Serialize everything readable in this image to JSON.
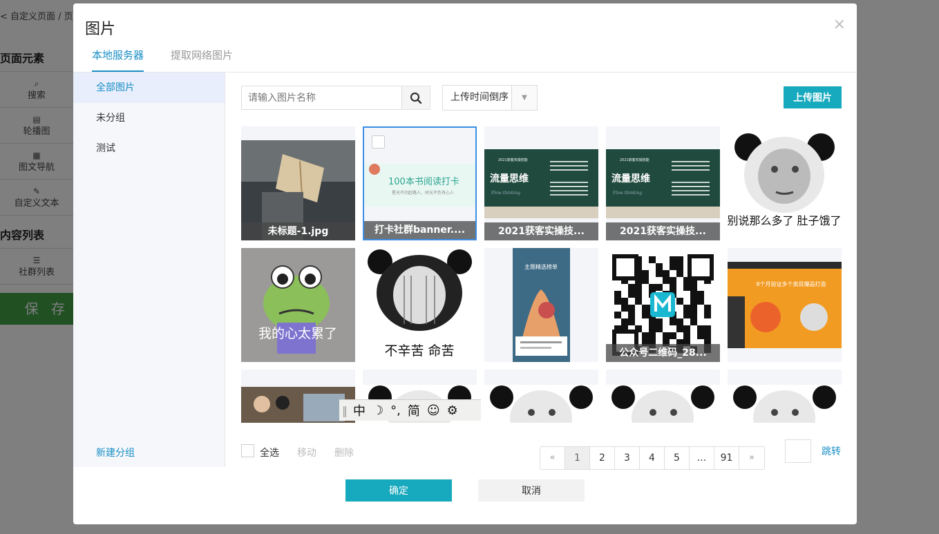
{
  "background": {
    "breadcrumb": "< 自定义页面 / 页",
    "section_page_elements": "页面元素",
    "items": [
      {
        "label": "搜索",
        "icon": "search-icon"
      },
      {
        "label": "轮播图",
        "icon": "file-icon"
      },
      {
        "label": "图文导航",
        "icon": "grid-icon"
      },
      {
        "label": "自定义文本",
        "icon": "edit-icon"
      }
    ],
    "section_content_list": "内容列表",
    "content_items": [
      {
        "label": "社群列表",
        "icon": "list-icon"
      }
    ],
    "save_label": "保 存"
  },
  "modal": {
    "title": "图片",
    "close": "×",
    "tabs": [
      {
        "label": "本地服务器",
        "active": true
      },
      {
        "label": "提取网络图片",
        "active": false
      }
    ],
    "groups": [
      {
        "label": "全部图片",
        "active": true
      },
      {
        "label": "未分组",
        "active": false
      },
      {
        "label": "测试",
        "active": false
      }
    ],
    "new_group": "新建分组",
    "search": {
      "placeholder": "请输入图片名称",
      "value": ""
    },
    "sort": {
      "selected": "上传时间倒序"
    },
    "upload_label": "上传图片",
    "images": [
      {
        "caption": "未标题-1.jpg",
        "kind": "book",
        "selected": false
      },
      {
        "caption": "打卡社群banner....",
        "kind": "banner",
        "banner_title": "100本书阅读打卡",
        "banner_sub": "星光不问赶路人，时光不负有心人",
        "selected": true
      },
      {
        "caption": "2021获客实操技...",
        "kind": "slide",
        "slide_title": "流量思维",
        "slide_head": "2021获客实操技能",
        "slide_sub": "Flow thinking",
        "selected": false
      },
      {
        "caption": "2021获客实操技...",
        "kind": "slide",
        "slide_title": "流量思维",
        "slide_head": "2021获客实操技能",
        "slide_sub": "Flow thinking",
        "selected": false
      },
      {
        "caption": "",
        "kind": "meme",
        "meme_text": "别说那么多了 肚子饿了",
        "selected": false
      },
      {
        "caption": "",
        "kind": "frog",
        "meme_text": "我的心太累了",
        "selected": false
      },
      {
        "caption": "",
        "kind": "meme2",
        "meme_text": "不辛苦 命苦",
        "selected": false
      },
      {
        "caption": "",
        "kind": "phone",
        "phone_title": "主题精选榜单",
        "selected": false
      },
      {
        "caption": "公众号二维码_28...",
        "kind": "qr",
        "selected": false
      },
      {
        "caption": "",
        "kind": "orange",
        "orange_title": "8个月验证多个类目爆品打造",
        "selected": false
      },
      {
        "caption": "",
        "kind": "photo",
        "selected": false
      },
      {
        "caption": "",
        "kind": "panda",
        "selected": false
      },
      {
        "caption": "",
        "kind": "panda",
        "selected": false
      },
      {
        "caption": "",
        "kind": "panda",
        "selected": false
      },
      {
        "caption": "",
        "kind": "panda",
        "selected": false
      }
    ],
    "select_all": "全选",
    "move": "移动",
    "delete": "删除",
    "pagination": {
      "prev": "«",
      "pages": [
        "1",
        "2",
        "3",
        "4",
        "5",
        "...",
        "91"
      ],
      "current": "1",
      "next": "»",
      "jump_label": "跳转"
    },
    "ok": "确定",
    "cancel": "取消"
  },
  "ime_toolbar": {
    "items": [
      "中",
      "☽",
      "°,",
      "简",
      "☺",
      "⚙"
    ]
  },
  "colors": {
    "accent": "#17a9bd",
    "link": "#1a8fc5",
    "selected_border": "#3a8ee6",
    "save_green": "#43a047"
  }
}
